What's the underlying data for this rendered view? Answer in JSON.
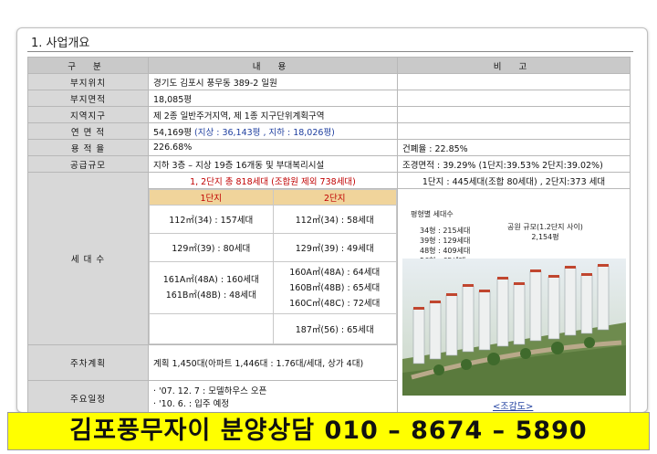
{
  "section_title": "1. 사업개요",
  "table": {
    "headers": [
      "구 분",
      "내 용",
      "비 고"
    ],
    "rows": [
      {
        "label": "부지위치",
        "content": "경기도 김포시 풍무동 389-2 일원",
        "note": ""
      },
      {
        "label": "부지면적",
        "content": "18,085평",
        "note": ""
      },
      {
        "label": "지역지구",
        "content": "제 2종 일반주거지역, 제 1종 지구단위계획구역",
        "note": ""
      },
      {
        "label": "연 면 적",
        "content": "54,169평",
        "content_sub": "(지상 : 36,143평 ,  지하 : 18,026평)",
        "note": ""
      },
      {
        "label": "용 적 율",
        "content": "226.68%",
        "note": "건폐율 : 22.85%"
      },
      {
        "label": "공급규모",
        "content": "지하 3층 – 지상 19층 16개동 및 부대복리시설",
        "note": "조경면적 : 39.29%  (1단지:39.53% 2단지:39.02%)"
      }
    ],
    "household": {
      "label": "세 대 수",
      "summary": "1, 2단지 총 818세대 (조합원 제외 738세대)",
      "note": "1단지 : 445세대(조합 80세대) , 2단지:373 세대",
      "complex1_header": "1단지",
      "complex2_header": "2단지",
      "complex1": [
        "112㎡(34)  :  157세대",
        "129㎡(39)  :   80세대",
        "161A㎡(48A) :  160세대",
        "161B㎡(48B) :   48세대",
        ""
      ],
      "complex2": [
        "112㎡(34)  :   58세대",
        "129㎡(39)  :  49세대",
        "160A㎡(48A) :  64세대",
        "160B㎡(48B) :  65세대",
        "160C㎡(48C) :  72세대",
        "187㎡(56)  :  65세대"
      ]
    },
    "parking": {
      "label": "주차계획",
      "content": "계획 1,450대(아파트 1,446대 : 1.76대/세대, 상가 4대)"
    },
    "schedule": {
      "label": "주요일정",
      "lines": [
        "· '07. 12. 7          :    모델하우스 오픈",
        "· '10.   6.            :    입주 예정"
      ]
    }
  },
  "image_panel": {
    "pyeong_title": "평형별 세대수",
    "pyeong_list": [
      "34형 : 215세대",
      "39형 : 129세대",
      "48형 : 409세대",
      "56형 :   65세대"
    ],
    "park_title": "공원 규모(1.2단지 사이)",
    "park_value": "2,154평",
    "caption": "<조감도>"
  },
  "banner": "김포풍무자이 분양상담 010 – 8674 – 5890",
  "colors": {
    "banner_bg": "#ffff00",
    "header_bg": "#c9c9c9",
    "unit_header_bg": "#f0d49b",
    "highlight_red": "#c00000",
    "sub_blue": "#1f3f9f"
  }
}
